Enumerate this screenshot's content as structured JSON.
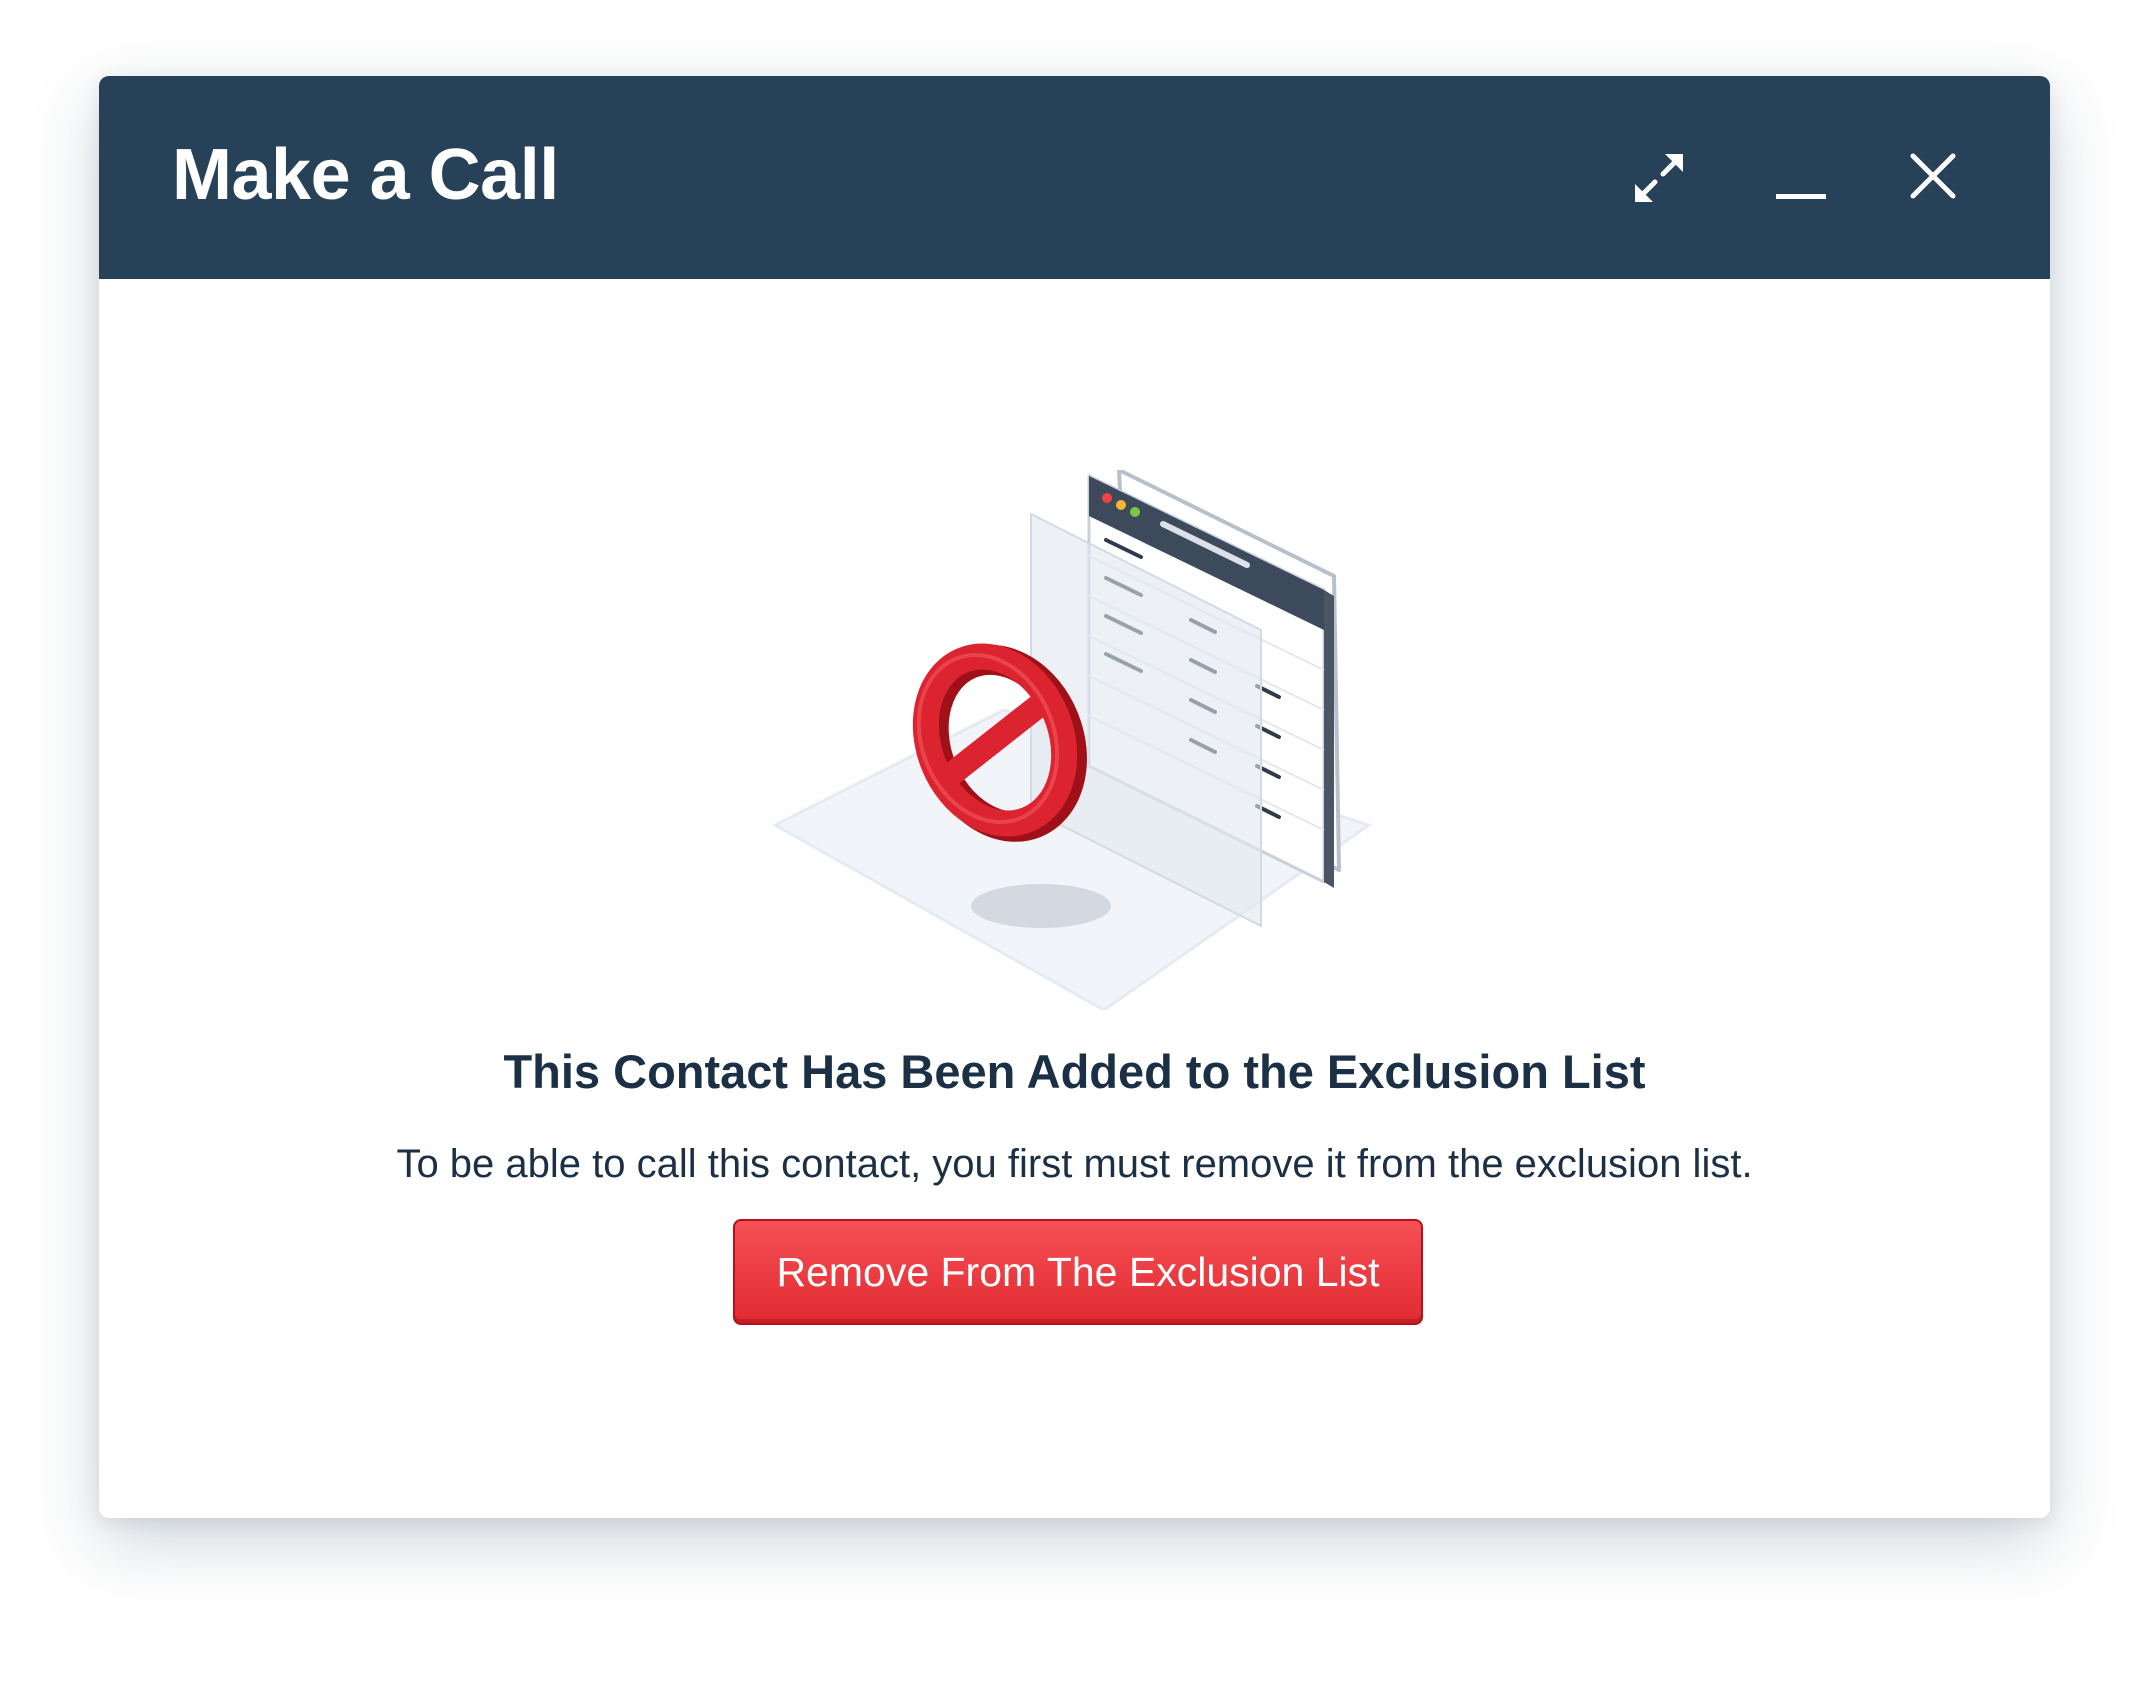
{
  "dialog": {
    "title": "Make a Call",
    "controls": {
      "expand_icon": "expand-arrows-icon",
      "minimize_icon": "minimize-icon",
      "close_icon": "close-icon"
    }
  },
  "illustration": {
    "icon": "exclusion-list-illustration"
  },
  "content": {
    "heading": "This Contact Has Been Added to the Exclusion List",
    "message": "To be able to call this contact, you first must remove it from the exclusion list."
  },
  "actions": {
    "remove_label": "Remove From The Exclusion List"
  },
  "colors": {
    "header_bg": "#264158",
    "text_dark": "#1c3045",
    "button_red": "#e5353b",
    "prohibit_red": "#d7232c"
  }
}
